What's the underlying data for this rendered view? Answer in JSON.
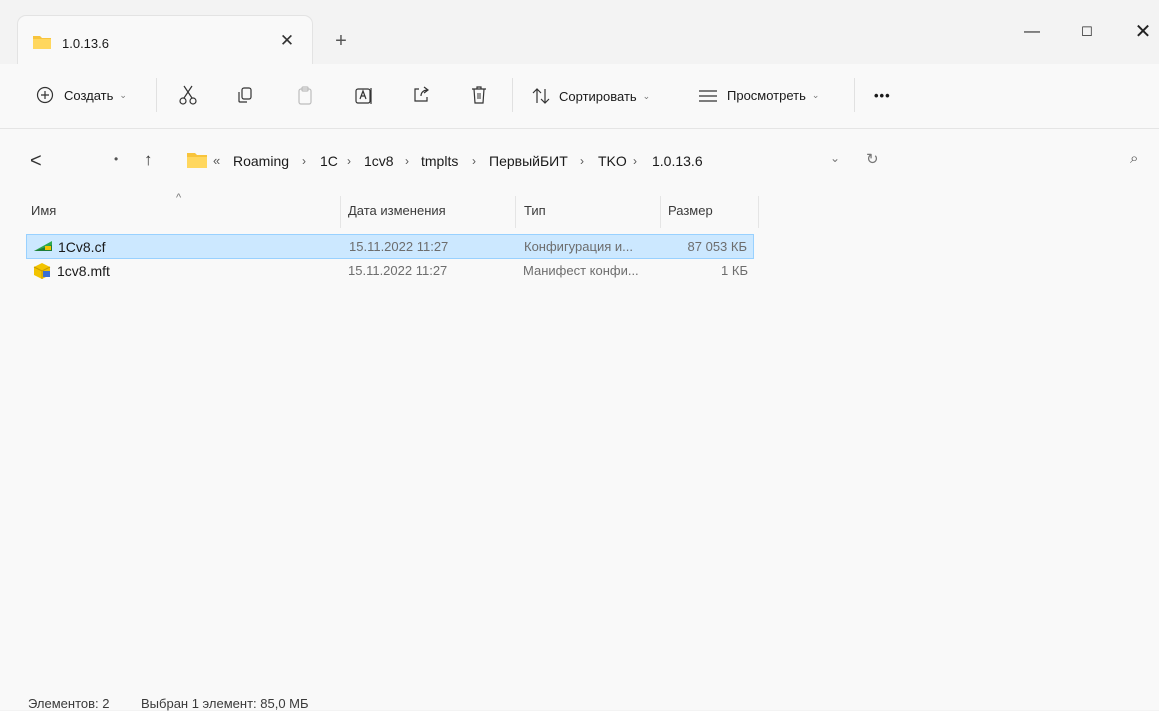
{
  "window": {
    "tab_title": "1.0.13.6",
    "tab_close": "✕",
    "new_tab": "+",
    "minimize": "—",
    "maximize": "☐",
    "close": "✕"
  },
  "toolbar": {
    "create_label": "Создать",
    "sort_label": "Сортировать",
    "view_label": "Просмотреть",
    "more_label": "•••",
    "dropdown_caret": "⌄"
  },
  "address": {
    "back": "<",
    "dot": "•",
    "up": "↑",
    "overflow": "«",
    "crumbs": [
      "Roaming",
      "1C",
      "1cv8",
      "tmplts",
      "ПервыйБИТ",
      "TKO",
      "1.0.13.6"
    ],
    "separator": "›",
    "dropdown": "⌄",
    "refresh": "↻",
    "search": "⌕"
  },
  "list": {
    "columns": {
      "name": "Имя",
      "date": "Дата изменения",
      "type": "Тип",
      "size": "Размер"
    },
    "sort_caret": "^",
    "rows": [
      {
        "name": "1Cv8.cf",
        "date": "15.11.2022 11:27",
        "type": "Конфигурация и...",
        "size": "87 053 КБ",
        "icon": "cf-file-icon",
        "selected": true
      },
      {
        "name": "1cv8.mft",
        "date": "15.11.2022 11:27",
        "type": "Манифест конфи...",
        "size": "1 КБ",
        "icon": "mft-file-icon",
        "selected": false
      }
    ]
  },
  "status": {
    "count": "Элементов: 2",
    "selection": "Выбран 1 элемент: 85,0 МБ"
  },
  "colors": {
    "selection_bg": "#cce8ff",
    "selection_border": "#99d1ff",
    "folder": "#f8c43c"
  }
}
